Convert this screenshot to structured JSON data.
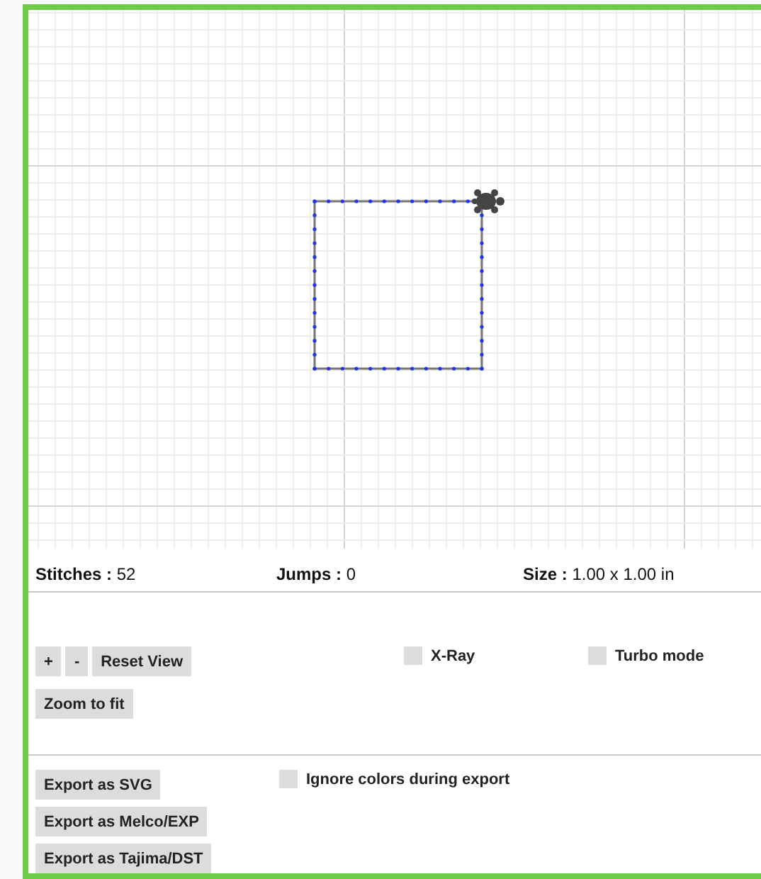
{
  "stats": [
    {
      "label": "Stitches :",
      "value": "52"
    },
    {
      "label": "Jumps :",
      "value": "0"
    },
    {
      "label": "Size :",
      "value": "1.00 x 1.00 in"
    }
  ],
  "view_buttons": [
    "+",
    "-",
    "Reset View"
  ],
  "zoom_button": "Zoom to fit",
  "view_options": [
    {
      "label": "X-Ray",
      "checked": false
    },
    {
      "label": "Turbo mode",
      "checked": false
    }
  ],
  "export_buttons": [
    "Export as SVG",
    "Export as Melco/EXP",
    "Export as Tajima/DST"
  ],
  "export_option": {
    "label": "Ignore colors during export",
    "checked": false
  }
}
